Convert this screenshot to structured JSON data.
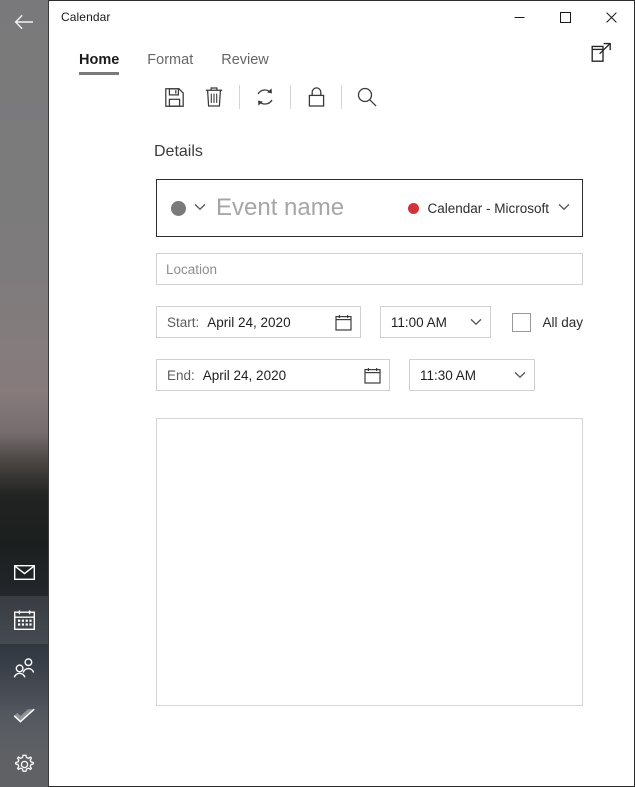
{
  "window": {
    "title": "Calendar",
    "caption_buttons": [
      {
        "name": "minimize",
        "glyph": "─",
        "label": "Minimize"
      },
      {
        "name": "maximize",
        "glyph": "□",
        "label": "Maximize"
      },
      {
        "name": "close",
        "glyph": "✕",
        "label": "Close"
      }
    ]
  },
  "sidebar": {
    "back_label": "Back",
    "back_icon": "back-arrow-icon",
    "items": [
      {
        "label": "Mail",
        "icon": "mail-icon",
        "selected": false
      },
      {
        "label": "Calendar",
        "icon": "calendar-icon",
        "selected": true
      },
      {
        "label": "People",
        "icon": "people-icon",
        "selected": false
      },
      {
        "label": "To Do",
        "icon": "checkmark-icon",
        "selected": false
      },
      {
        "label": "Settings",
        "icon": "gear-icon",
        "selected": false
      }
    ]
  },
  "ribbon": {
    "tabs": [
      {
        "label": "Home",
        "active": true
      },
      {
        "label": "Format",
        "active": false
      },
      {
        "label": "Review",
        "active": false
      }
    ],
    "popout": {
      "label": "Open in new window",
      "icon": "popout-icon"
    }
  },
  "commands": [
    {
      "label": "Save",
      "icon": "save-icon"
    },
    {
      "label": "Delete",
      "icon": "trash-icon"
    },
    {
      "separator": true
    },
    {
      "label": "Repeat",
      "icon": "repeat-icon"
    },
    {
      "separator": true
    },
    {
      "label": "Private",
      "icon": "lock-icon"
    },
    {
      "separator": true
    },
    {
      "label": "Search",
      "icon": "search-icon"
    }
  ],
  "details": {
    "heading": "Details",
    "event": {
      "color_dot": "#7a7a7a",
      "color_dropdown_icon": "chevron-down-icon",
      "name_value": "",
      "name_placeholder": "Event name",
      "calendar_dot_color": "#d13438",
      "calendar_label": "Calendar - Microsoft",
      "calendar_dropdown_icon": "chevron-down-icon"
    },
    "location": {
      "value": "",
      "placeholder": "Location"
    },
    "start": {
      "label": "Start:",
      "date": "April 24, 2020",
      "date_icon": "calendar-picker-icon",
      "time": "11:00 AM",
      "time_icon": "chevron-down-icon"
    },
    "end": {
      "label": "End:",
      "date": "April 24, 2020",
      "date_icon": "calendar-picker-icon",
      "time": "11:30 AM",
      "time_icon": "chevron-down-icon"
    },
    "all_day": {
      "label": "All day",
      "checked": false
    },
    "notes": {
      "value": "",
      "placeholder": ""
    }
  }
}
